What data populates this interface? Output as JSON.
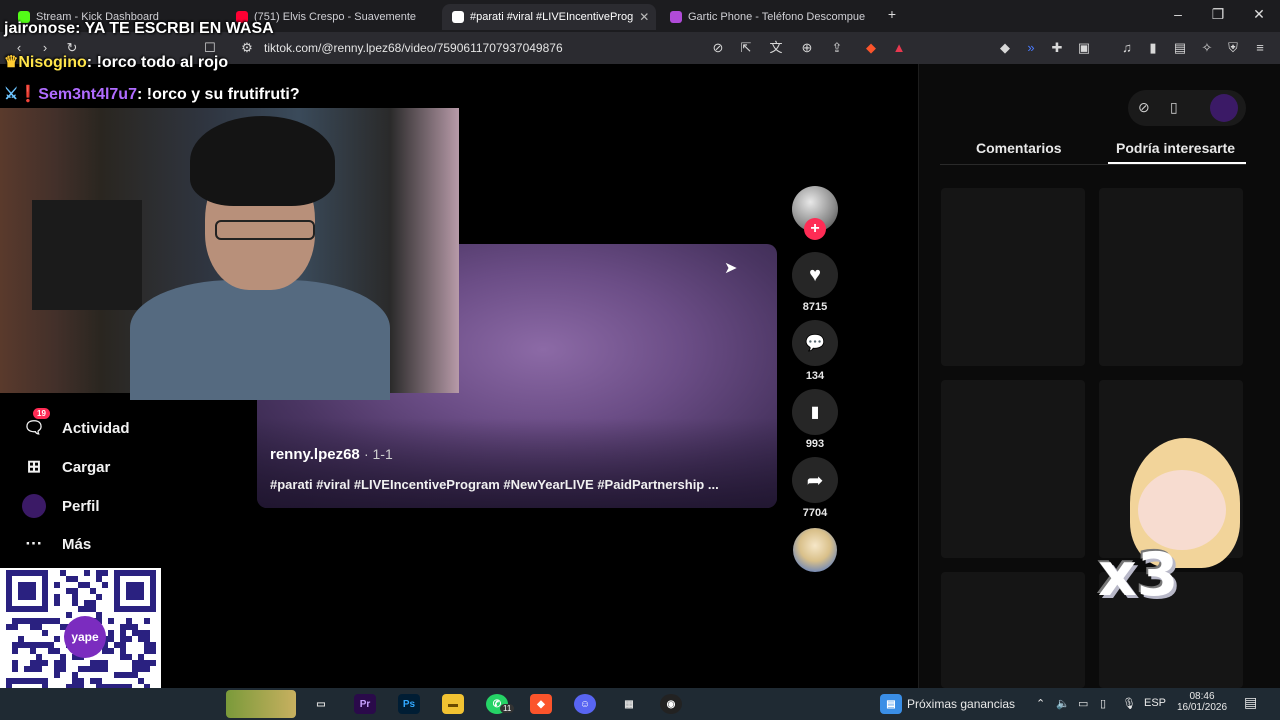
{
  "browser": {
    "tabs": [
      {
        "title": "Stream - Kick Dashboard",
        "color": "#53fc18",
        "active": false
      },
      {
        "title": "(751) Elvis Crespo - Suavemente",
        "color": "#ff0033",
        "active": false
      },
      {
        "title": "#parati #viral #LIVEIncentiveProg",
        "color": "#ffffff",
        "active": true
      },
      {
        "title": "Gartic Phone - Teléfono Descompue",
        "color": "#b04bd8",
        "active": false
      }
    ],
    "new_tab_symbol": "+",
    "url": "tiktok.com/@renny.lpez68/video/7590611707937049876"
  },
  "chat": [
    {
      "user": "jaironose",
      "message": "YA TE ESCRBI EN WASA",
      "user_color": "#ffffff"
    },
    {
      "user": "Nisogino",
      "message": "!orco todo al rojo",
      "user_color": "#ffe54a"
    },
    {
      "user": "Sem3nt4l7u7",
      "message": "!orco y su frutifruti?",
      "user_color": "#b06cff"
    }
  ],
  "sidebar": {
    "items": [
      {
        "label": "Actividad",
        "icon": "inbox-icon",
        "badge": "19"
      },
      {
        "label": "Cargar",
        "icon": "upload-icon"
      },
      {
        "label": "Perfil",
        "icon": "profile-avatar"
      },
      {
        "label": "Más",
        "icon": "more-icon"
      }
    ]
  },
  "video": {
    "author": "renny.lpez68",
    "date": "· 1-1",
    "caption": "#parati #viral #LIVEIncentiveProgram #NewYearLIVE #PaidPartnership ..."
  },
  "actions": {
    "likes": "8715",
    "comments": "134",
    "saves": "993",
    "shares": "7704"
  },
  "right_panel": {
    "tabs": [
      "Comentarios",
      "Podría interesarte"
    ],
    "active_tab": "Podría interesarte"
  },
  "qr": {
    "brand": "yape"
  },
  "sticker": {
    "text": "x3"
  },
  "taskbar": {
    "widget_label": "Próximas ganancias",
    "lang": "ESP",
    "time": "08:46",
    "date": "16/01/2026",
    "whatsapp_badge": "11"
  }
}
